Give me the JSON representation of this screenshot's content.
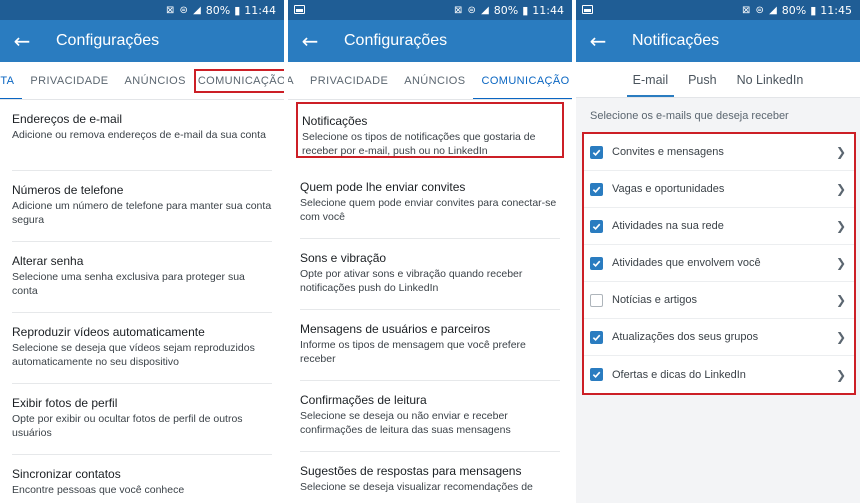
{
  "panel1": {
    "status": {
      "text": "80%",
      "time": "11:44",
      "icons": "⊠ ⊜ ◢"
    },
    "title": "Configurações",
    "tabs": [
      "NTA",
      "PRIVACIDADE",
      "ANÚNCIOS",
      "COMUNICAÇÃO"
    ],
    "items": [
      {
        "title": "Endereços de e-mail",
        "desc": "Adicione ou remova endereços de e-mail da sua conta"
      },
      {
        "title": "Números de telefone",
        "desc": "Adicione um número de telefone para manter sua conta segura"
      },
      {
        "title": "Alterar senha",
        "desc": "Selecione uma senha exclusiva para proteger sua conta"
      },
      {
        "title": "Reproduzir vídeos automaticamente",
        "desc": "Selecione se deseja que vídeos sejam reproduzidos automaticamente no seu dispositivo"
      },
      {
        "title": "Exibir fotos de perfil",
        "desc": "Opte por exibir ou ocultar fotos de perfil de outros usuários"
      },
      {
        "title": "Sincronizar contatos",
        "desc": "Encontre pessoas que você conhece"
      }
    ]
  },
  "panel2": {
    "status": {
      "text": "80%",
      "time": "11:44",
      "icons": "⊠ ⊜ ◢"
    },
    "title": "Configurações",
    "tabs": [
      "TA",
      "PRIVACIDADE",
      "ANÚNCIOS",
      "COMUNICAÇÃO"
    ],
    "items": [
      {
        "title": "Notificações",
        "desc": "Selecione os tipos de notificações que gostaria de receber por e-mail, push ou no LinkedIn"
      },
      {
        "title": "Quem pode lhe enviar convites",
        "desc": "Selecione quem pode enviar convites para conectar-se com você"
      },
      {
        "title": "Sons e vibração",
        "desc": "Opte por ativar sons e vibração quando receber notificações push do LinkedIn"
      },
      {
        "title": "Mensagens de usuários e parceiros",
        "desc": "Informe os tipos de mensagem que você prefere receber"
      },
      {
        "title": "Confirmações de leitura",
        "desc": "Selecione se deseja ou não enviar e receber confirmações de leitura das suas mensagens"
      },
      {
        "title": "Sugestões de respostas para mensagens",
        "desc": "Selecione se deseja visualizar recomendações de"
      }
    ]
  },
  "panel3": {
    "status": {
      "text": "80%",
      "time": "11:45",
      "icons": "⊠ ⊜ ◢"
    },
    "title": "Notificações",
    "subtabs": [
      "E-mail",
      "Push",
      "No LinkedIn"
    ],
    "section_label": "Selecione os e-mails que deseja receber",
    "options": [
      {
        "label": "Convites e mensagens",
        "checked": true
      },
      {
        "label": "Vagas e oportunidades",
        "checked": true
      },
      {
        "label": "Atividades na sua rede",
        "checked": true
      },
      {
        "label": "Atividades que envolvem você",
        "checked": true
      },
      {
        "label": "Notícias e artigos",
        "checked": false
      },
      {
        "label": "Atualizações dos seus grupos",
        "checked": true
      },
      {
        "label": "Ofertas e dicas do LinkedIn",
        "checked": true
      }
    ]
  },
  "colors": {
    "appbar": "#2a7cc0",
    "statusbar": "#1f5d95",
    "highlight": "#cc1f26",
    "accent": "#0a66c2"
  },
  "icons": {
    "back": "arrow-left-icon",
    "chevron": "chevron-right-icon",
    "check": "checkmark-icon"
  }
}
